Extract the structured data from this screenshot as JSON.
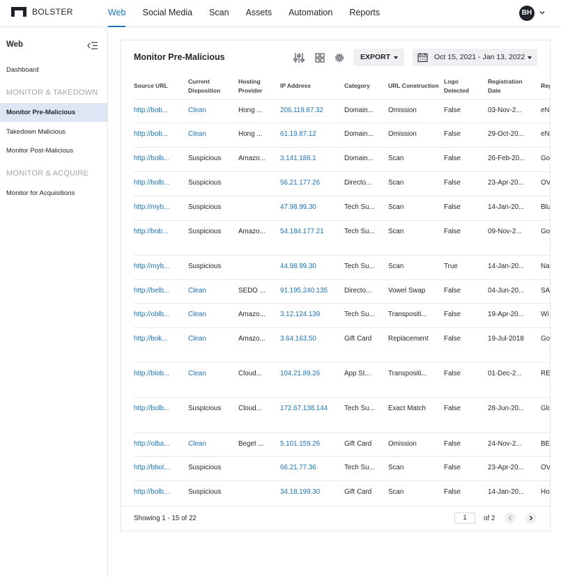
{
  "brand": {
    "name": "BOLSTER"
  },
  "nav": {
    "items": [
      "Web",
      "Social Media",
      "Scan",
      "Assets",
      "Automation",
      "Reports"
    ],
    "active": "Web"
  },
  "user": {
    "initials": "BH"
  },
  "sidebar": {
    "title": "Web",
    "dashboard": "Dashboard",
    "section1": "MONITOR & TAKEDOWN",
    "item_pre": "Monitor Pre-Malicious",
    "item_takedown": "Takedown Malicious",
    "item_post": "Monitor Post-Malicious",
    "section2": "MONITOR & ACQUIRE",
    "item_acq": "Monitor for Acquisitions"
  },
  "card": {
    "title": "Monitor Pre-Malicious",
    "export_label": "EXPORT",
    "date_range": "Oct 15, 2021 - Jan 13, 2022"
  },
  "table": {
    "columns": [
      "Source URL",
      "Current Disposition",
      "Hosting Provider",
      "IP Address",
      "Category",
      "URL Construction",
      "Logo Detected",
      "Registration Date",
      "Reg"
    ],
    "rows": [
      [
        "http://bob...",
        "Clean",
        "Hong ...",
        "206.119.87.32",
        "Domain...",
        "Omission",
        "False",
        "03-Nov-2...",
        "eN"
      ],
      [
        "http://bob...",
        "Clean",
        "Hong ...",
        "61.19.87.12",
        "Domain...",
        "Omission",
        "False",
        "29-Oct-20...",
        "eN"
      ],
      [
        "http://bolb...",
        "Suspicious",
        "Amazo...",
        "3.141.188.1",
        "Domain...",
        "Scan",
        "False",
        "26-Feb-20...",
        "Go"
      ],
      [
        "http://bolb...",
        "Suspicious",
        "",
        "56.21.177.26",
        "Directo...",
        "Scan",
        "False",
        "23-Apr-20...",
        "OV"
      ],
      [
        "http://myb...",
        "Suspicious",
        "",
        "47.98.99.30",
        "Tech Su...",
        "Scan",
        "False",
        "14-Jan-20...",
        "Blu"
      ],
      [
        "http://bob...",
        "Suspicious",
        "Amazo...",
        "54.184.177.21",
        "Tech Su...",
        "Scan",
        "False",
        "09-Nov-2...",
        "Go"
      ],
      [
        "http://myb...",
        "Suspicious",
        "",
        "44.98.99.30",
        "Tech Su...",
        "Scan",
        "True",
        "14-Jan-20...",
        "Na"
      ],
      [
        "http://belb...",
        "Clean",
        "SEDO ...",
        "91.195.240.135",
        "Directo...",
        "Vowel Swap",
        "False",
        "04-Jun-20...",
        "SA"
      ],
      [
        "http://oblb...",
        "Clean",
        "Amazo...",
        "3.12.124.139",
        "Tech Su...",
        "Transpositi...",
        "False",
        "19-Apr-20...",
        "Wi"
      ],
      [
        "http://bok...",
        "Clean",
        "Amazo...",
        "3.64.163.50",
        "Gift Card",
        "Replacement",
        "False",
        "19-Jul-2018",
        "Go"
      ],
      [
        "http://blob...",
        "Clean",
        "Cloud...",
        "104.21.89.26",
        "App St...",
        "Transpositi...",
        "False",
        "01-Dec-2...",
        "RE"
      ],
      [
        "http://bolb...",
        "Suspicious",
        "Cloud...",
        "172.67.138.144",
        "Tech Su...",
        "Exact Match",
        "False",
        "28-Jun-20...",
        "Glo"
      ],
      [
        "http://olba...",
        "Clean",
        "Beget ...",
        "5.101.159.26",
        "Gift Card",
        "Omission",
        "False",
        "24-Nov-2...",
        "BE"
      ],
      [
        "http://bbol...",
        "Suspicious",
        "",
        "66.21.77.36",
        "Tech Su...",
        "Scan",
        "False",
        "23-Apr-20...",
        "OV"
      ],
      [
        "http://bolb...",
        "Suspicious",
        "",
        "34.18.199.30",
        "Gift Card",
        "Scan",
        "False",
        "14-Jan-20...",
        "Ho"
      ]
    ]
  },
  "footer": {
    "showing": "Showing 1 - 15 of 22",
    "page": "1",
    "of_pages": "of 2"
  },
  "colors": {
    "accent": "#1a73b8",
    "active_bg": "#dde6f4"
  }
}
